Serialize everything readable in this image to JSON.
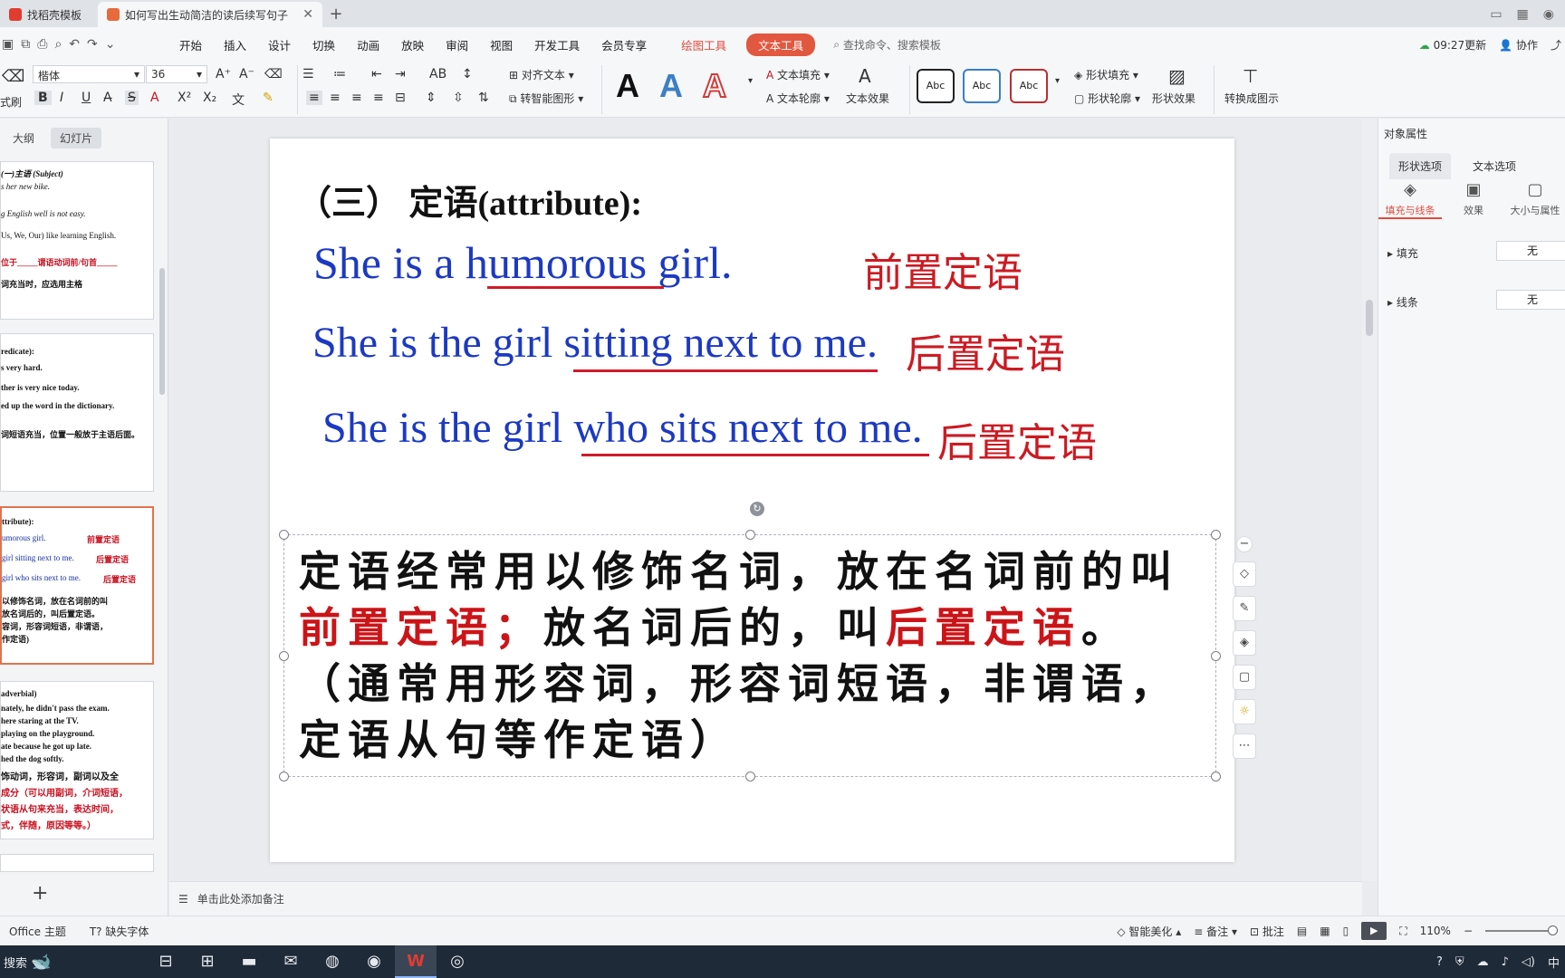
{
  "tabs": [
    {
      "label": "找稻壳模板",
      "icon": "wps-logo-icon",
      "active": false
    },
    {
      "label": "如何写出生动简洁的读后续写句子",
      "icon": "presentation-file-icon",
      "active": true
    }
  ],
  "menu": {
    "items": [
      "开始",
      "插入",
      "设计",
      "切换",
      "动画",
      "放映",
      "审阅",
      "视图",
      "开发工具",
      "会员专享"
    ],
    "drawing_tools": "绘图工具",
    "text_tools": "文本工具",
    "search_placeholder": "查找命令、搜索模板",
    "update_status": "09:27更新",
    "collaborate": "协作"
  },
  "ribbon": {
    "format_painter": "式刷",
    "font_name": "楷体",
    "font_size": "36",
    "align_text": "对齐文本",
    "smart_graphic": "转智能图形",
    "text_fill": "文本填充",
    "text_outline": "文本轮廓",
    "text_effect": "文本效果",
    "shape_fill": "形状填充",
    "shape_outline": "形状轮廓",
    "shape_effect": "形状效果",
    "convert_to_diagram": "转换成图示",
    "style_sample": "Abc",
    "wordart": [
      "A",
      "A",
      "A"
    ]
  },
  "left_pane": {
    "tabs": [
      "大纲",
      "幻灯片"
    ],
    "slide1": [
      "(一)主语 (Subject)",
      "s her new bike.",
      "g English well is not easy.",
      "Us, We, Our) like learning English.",
      "位于_____谓语动词前/句首_____",
      "词充当时，应选用主格"
    ],
    "slide2": [
      "redicate):",
      "s very hard.",
      "ther is very nice today.",
      "ed up the word in the dictionary.",
      "词短语充当，位置一般放于主语后面。"
    ],
    "slide3": [
      "ttribute):",
      "umorous girl.",
      "girl sitting next to me.",
      "girl who sits next to me.",
      "以修饰名词，放在名词前的叫",
      "放名词后的，叫后置定语。",
      "容词，形容词短语，非谓语，",
      "作定语)"
    ],
    "slide3_labels": [
      "前置定语",
      "后置定语",
      "后置定语"
    ],
    "slide4": [
      "adverbial)",
      "nately, he didn't pass the exam.",
      "here staring at the TV.",
      "playing on the playground.",
      "ate because he got up late.",
      "hed the dog softly.",
      "饰动词，形容词，副词以及全",
      "成分（可以用副词，介词短语，",
      "状语从句来充当，表达时间，",
      "式，伴随，原因等等。）"
    ]
  },
  "slide": {
    "heading": "（三）  定语(attribute):",
    "sentences": [
      {
        "text": "She is a humorous girl.",
        "label": "前置定语"
      },
      {
        "text": "She is the girl sitting next to me.",
        "label": "后置定语"
      },
      {
        "text": "She is the girl who sits next to me.",
        "label": "后置定语"
      }
    ],
    "body": {
      "line1": "定语经常用以修饰名词，放在名词前的叫",
      "line2_red1": "前置定语；",
      "line2_black": "放名词后的，叫",
      "line2_red2": "后置定语",
      "line2_end": "。",
      "line3": "（通常用形容词，形容词短语，非谓语，",
      "line4": "定语从句等作定语）"
    }
  },
  "notes_placeholder": "单击此处添加备注",
  "right_panel": {
    "title": "对象属性",
    "tabs": [
      "形状选项",
      "文本选项"
    ],
    "subtabs": [
      "填充与线条",
      "效果",
      "大小与属性"
    ],
    "fill_label": "填充",
    "fill_value": "无",
    "line_label": "线条",
    "line_value": "无"
  },
  "status": {
    "theme": "Office 主题",
    "missing_font": "缺失字体",
    "smart_beautify": "智能美化",
    "notes": "备注",
    "comments": "批注",
    "zoom": "110%"
  },
  "taskbar": {
    "search": "搜索",
    "ime": "中"
  },
  "colors": {
    "accent": "#e2573f",
    "sentence_blue": "#1c39c4",
    "label_red": "#cc1a22"
  }
}
